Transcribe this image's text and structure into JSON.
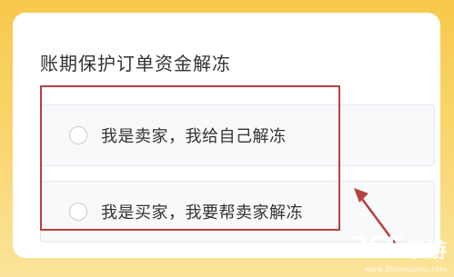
{
  "dialog": {
    "title": "账期保护订单资金解冻",
    "options": [
      {
        "label": "我是卖家，我给自己解冻",
        "selected": false
      },
      {
        "label": "我是买家，我要帮卖家解冻",
        "selected": false
      }
    ]
  },
  "watermark": {
    "brand_number": "365",
    "brand_name": "手游",
    "url": "www.365shouyou.com"
  },
  "colors": {
    "background": "#f7c94c",
    "annotation": "#b6413d",
    "text": "#333333"
  }
}
